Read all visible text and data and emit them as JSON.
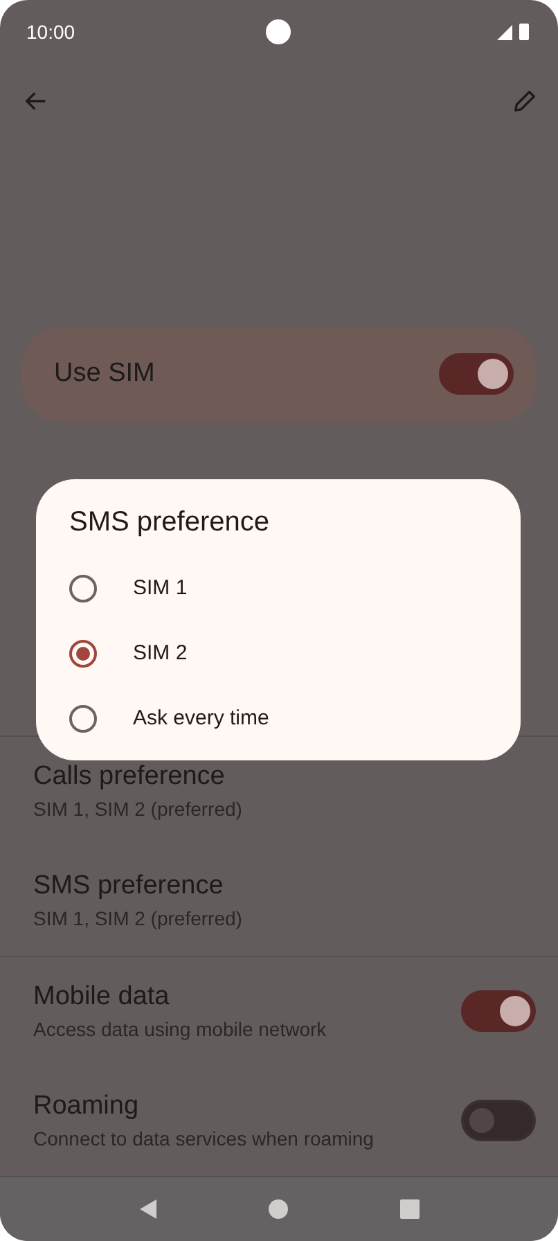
{
  "status_bar": {
    "time": "10:00"
  },
  "use_sim": {
    "label": "Use SIM",
    "on": true
  },
  "dialog": {
    "title": "SMS preference",
    "options": [
      {
        "label": "SIM 1",
        "selected": false
      },
      {
        "label": "SIM 2",
        "selected": true
      },
      {
        "label": "Ask every time",
        "selected": false
      }
    ]
  },
  "sections": [
    {
      "items": [
        {
          "kind": "text",
          "title": "Calls preference",
          "subtitle": "SIM 1, SIM 2 (preferred)"
        },
        {
          "kind": "text",
          "title": "SMS preference",
          "subtitle": "SIM 1, SIM 2 (preferred)"
        }
      ]
    },
    {
      "items": [
        {
          "kind": "switch",
          "title": "Mobile data",
          "subtitle": "Access data using mobile network",
          "on": true
        },
        {
          "kind": "switch",
          "title": "Roaming",
          "subtitle": "Connect to data services when roaming",
          "on": false
        }
      ]
    }
  ]
}
